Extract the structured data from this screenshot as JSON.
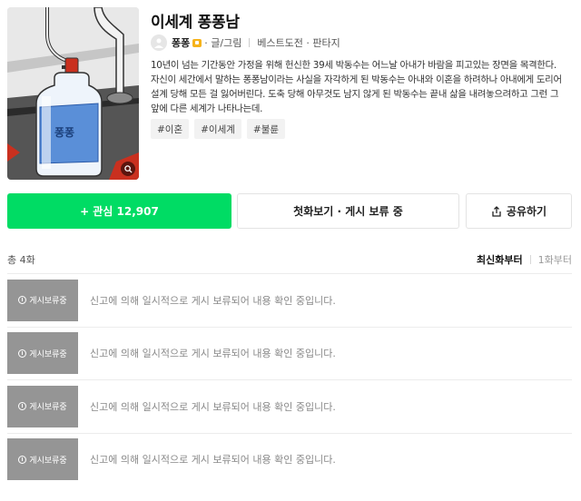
{
  "work": {
    "title": "이세계 퐁퐁남",
    "author": "퐁퐁",
    "role": "· 글/그림",
    "category": "베스트도전 · 판타지",
    "bottle_label": "퐁퐁",
    "synopsis": [
      "10년이 넘는 기간동안 가정을 위해 헌신한 39세 박동수는 어느날 아내가 바람을 피고있는 장면을 목격한다.",
      "자신이 세간에서 말하는 퐁퐁남이라는 사실을 자각하게 된 박동수는 아내와 이혼을 하려하나 아내에게 도리어",
      "설계 당해 모든 걸 잃어버린다. 도축 당해 아무것도 남지 않게 된 박동수는 끝내 삶을 내려놓으려하고 그런 그",
      "앞에 다른 세계가 나타나는데."
    ],
    "tags": [
      "#이혼",
      "#이세계",
      "#불륜"
    ]
  },
  "actions": {
    "favorite_plus": "+",
    "favorite_label": "관심 12,907",
    "first_episode_label": "첫화보기 · 게시 보류 중",
    "share_label": "공유하기"
  },
  "list_header": {
    "count": "총 4화",
    "sort_latest": "최신화부터",
    "sort_first": "1화부터"
  },
  "episodes": [
    {
      "badge": "게시보류중",
      "text": "신고에 의해 일시적으로 게시 보류되어 내용 확인 중입니다."
    },
    {
      "badge": "게시보류중",
      "text": "신고에 의해 일시적으로 게시 보류되어 내용 확인 중입니다."
    },
    {
      "badge": "게시보류중",
      "text": "신고에 의해 일시적으로 게시 보류되어 내용 확인 중입니다."
    },
    {
      "badge": "게시보류중",
      "text": "신고에 의해 일시적으로 게시 보류되어 내용 확인 중입니다."
    }
  ],
  "icons": {
    "zoom": "magnifier-icon",
    "avatar": "user-avatar-icon",
    "badge": "creator-badge-icon",
    "share": "share-icon",
    "hold": "hold-status-icon"
  },
  "colors": {
    "accent": "#00dc64",
    "hold_thumb": "#959595",
    "badge": "#f6b31b"
  }
}
